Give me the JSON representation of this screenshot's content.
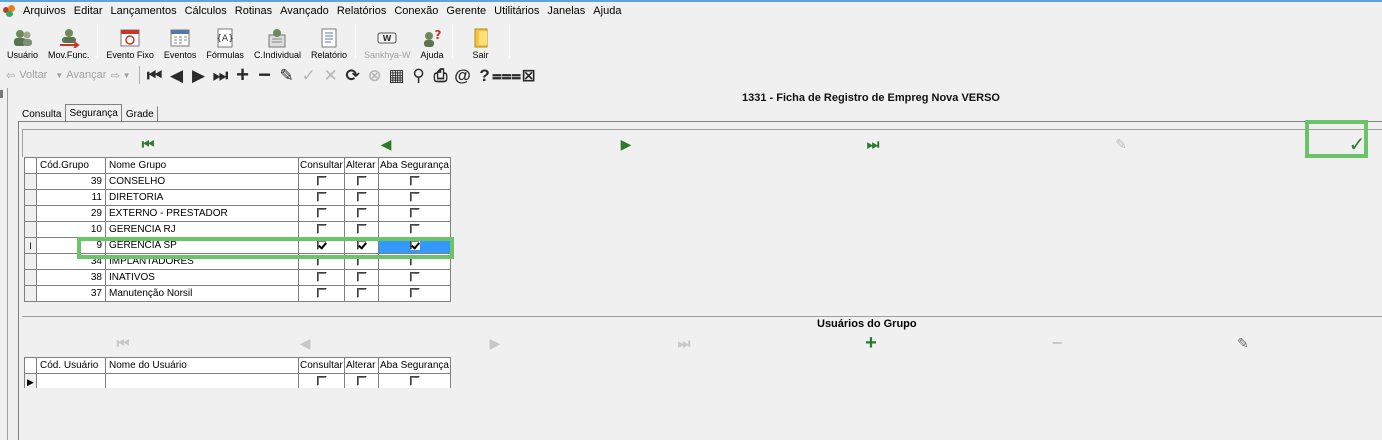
{
  "menubar": {
    "items": [
      "Arquivos",
      "Editar",
      "Lançamentos",
      "Cálculos",
      "Rotinas",
      "Avançado",
      "Relatórios",
      "Conexão",
      "Gerente",
      "Utilitários",
      "Janelas",
      "Ajuda"
    ]
  },
  "toolbar": {
    "buttons": [
      {
        "label": "Usuário",
        "icon": "users-icon"
      },
      {
        "label": "Mov.Func.",
        "icon": "employee-move-icon"
      },
      {
        "label": "Evento Fixo",
        "icon": "calendar-fixed-icon"
      },
      {
        "label": "Eventos",
        "icon": "calendar-icon"
      },
      {
        "label": "Fórmulas",
        "icon": "formula-icon"
      },
      {
        "label": "C.Individual",
        "icon": "individual-calc-icon"
      },
      {
        "label": "Relatório",
        "icon": "report-icon"
      },
      {
        "label": "Sankhya-W",
        "icon": "sankhya-icon"
      },
      {
        "label": "Ajuda",
        "icon": "help-icon"
      },
      {
        "label": "Sair",
        "icon": "exit-icon"
      }
    ]
  },
  "navbar": {
    "back_label": "Voltar",
    "forward_label": "Avançar"
  },
  "form": {
    "title": "1331 - Ficha de Registro de Empreg Nova VERSO"
  },
  "tabs": [
    {
      "label": "Consulta"
    },
    {
      "label": "Segurança"
    },
    {
      "label": "Grade"
    }
  ],
  "groups_grid": {
    "headers": {
      "code": "Cód.Grupo",
      "name": "Nome Grupo",
      "consultar": "Consultar",
      "alterar": "Alterar",
      "aba": "Aba Segurança"
    },
    "rows": [
      {
        "code": "39",
        "name": "CONSELHO",
        "consultar": false,
        "alterar": false,
        "aba": false
      },
      {
        "code": "11",
        "name": "DIRETORIA",
        "consultar": false,
        "alterar": false,
        "aba": false
      },
      {
        "code": "29",
        "name": "EXTERNO - PRESTADOR",
        "consultar": false,
        "alterar": false,
        "aba": false
      },
      {
        "code": "10",
        "name": "GERENCIA RJ",
        "consultar": false,
        "alterar": false,
        "aba": false
      },
      {
        "code": "9",
        "name": "GERENCIA SP",
        "consultar": true,
        "alterar": true,
        "aba": true
      },
      {
        "code": "34",
        "name": "IMPLANTADORES",
        "consultar": false,
        "alterar": false,
        "aba": false
      },
      {
        "code": "38",
        "name": "INATIVOS",
        "consultar": false,
        "alterar": false,
        "aba": false
      },
      {
        "code": "37",
        "name": "Manutenção Norsil",
        "consultar": false,
        "alterar": false,
        "aba": false
      }
    ],
    "current_row_indicator": "I"
  },
  "users_section": {
    "title": "Usuários do Grupo"
  },
  "users_grid": {
    "headers": {
      "code": "Cód. Usuário",
      "name": "Nome do Usuário",
      "consultar": "Consultar",
      "alterar": "Alterar",
      "aba": "Aba Segurança"
    },
    "rows": [
      {
        "code": "",
        "name": "",
        "consultar": false,
        "alterar": false,
        "aba": false
      }
    ],
    "current_row_indicator": "▶"
  },
  "colors": {
    "highlight": "#6cc46a",
    "selection": "#3399ff",
    "nav_green": "#2d7a2d"
  }
}
